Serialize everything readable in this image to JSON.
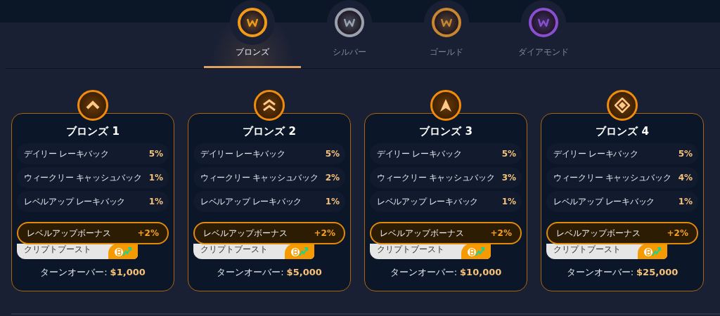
{
  "tabs": [
    {
      "label": "ブロンズ",
      "selected": true,
      "color": "#f09a18"
    },
    {
      "label": "シルバー",
      "selected": false,
      "color": "#9aa1ad"
    },
    {
      "label": "ゴールド",
      "selected": false,
      "color": "#c8862e"
    },
    {
      "label": "ダイアモンド",
      "selected": false,
      "color": "#8a4fd0"
    }
  ],
  "cards": [
    {
      "title": "ブロンズ 1",
      "kind": "chevron",
      "rows": [
        {
          "label": "デイリー レーキバック",
          "value": "5%"
        },
        {
          "label": "ウィークリー キャッシュバック",
          "value": "1%"
        },
        {
          "label": "レベルアップ レーキバック",
          "value": "1%"
        }
      ],
      "bonus": {
        "label": "レベルアップボーナス",
        "value": "+2%"
      },
      "boost": "クリプトブースト",
      "turnover_label": "ターンオーバー:",
      "turnover": "$1,000"
    },
    {
      "title": "ブロンズ 2",
      "kind": "double-chevron",
      "rows": [
        {
          "label": "デイリー レーキバック",
          "value": "5%"
        },
        {
          "label": "ウィークリー キャッシュバック",
          "value": "2%"
        },
        {
          "label": "レベルアップ レーキバック",
          "value": "1%"
        }
      ],
      "bonus": {
        "label": "レベルアップボーナス",
        "value": "+2%"
      },
      "boost": "クリプトブースト",
      "turnover_label": "ターンオーバー:",
      "turnover": "$5,000"
    },
    {
      "title": "ブロンズ 3",
      "kind": "arrow",
      "rows": [
        {
          "label": "デイリー レーキバック",
          "value": "5%"
        },
        {
          "label": "ウィークリー キャッシュバック",
          "value": "3%"
        },
        {
          "label": "レベルアップ レーキバック",
          "value": "1%"
        }
      ],
      "bonus": {
        "label": "レベルアップボーナス",
        "value": "+2%"
      },
      "boost": "クリプトブースト",
      "turnover_label": "ターンオーバー:",
      "turnover": "$10,000"
    },
    {
      "title": "ブロンズ 4",
      "kind": "diamond",
      "rows": [
        {
          "label": "デイリー レーキバック",
          "value": "5%"
        },
        {
          "label": "ウィークリー キャッシュバック",
          "value": "4%"
        },
        {
          "label": "レベルアップ レーキバック",
          "value": "1%"
        }
      ],
      "bonus": {
        "label": "レベルアップボーナス",
        "value": "+2%"
      },
      "boost": "クリプトブースト",
      "turnover_label": "ターンオーバー:",
      "turnover": "$25,000"
    }
  ]
}
